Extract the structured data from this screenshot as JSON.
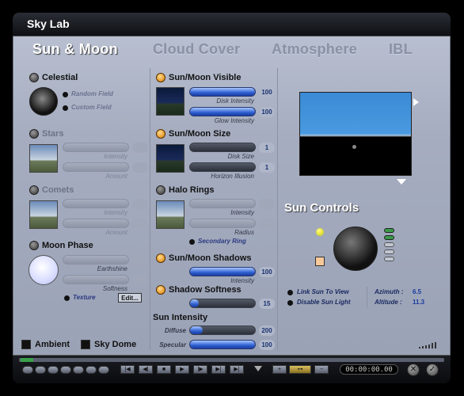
{
  "window": {
    "title": "Sky Lab"
  },
  "tabs": [
    {
      "label": "Sun & Moon",
      "active": true
    },
    {
      "label": "Cloud Cover",
      "active": false
    },
    {
      "label": "Atmosphere",
      "active": false
    },
    {
      "label": "IBL",
      "active": false
    }
  ],
  "left": {
    "celestial": {
      "label": "Celestial",
      "random_field": "Random Field",
      "custom_field": "Custom Field"
    },
    "stars": {
      "label": "Stars",
      "intensity": "Intensity",
      "amount": "Amount"
    },
    "comets": {
      "label": "Comets",
      "intensity": "Intensity",
      "amount": "Amount"
    },
    "moon_phase": {
      "label": "Moon Phase",
      "earthshine": "Earthshine",
      "softness": "Softness",
      "texture": "Texture",
      "edit": "Edit..."
    },
    "ambient": "Ambient",
    "sky_dome": "Sky Dome"
  },
  "middle": {
    "sun_moon_visible": {
      "label": "Sun/Moon Visible",
      "disk_intensity": "Disk Intensity",
      "disk_intensity_value": "100",
      "glow_intensity": "Glow Intensity",
      "glow_intensity_value": "100"
    },
    "sun_moon_size": {
      "label": "Sun/Moon Size",
      "disk_size": "Disk Size",
      "disk_size_value": "1",
      "horizon_illusion": "Horizon Illusion",
      "horizon_illusion_value": "1"
    },
    "halo_rings": {
      "label": "Halo Rings",
      "intensity": "Intensity",
      "radius": "Radius",
      "secondary_ring": "Secondary Ring"
    },
    "sun_moon_shadows": {
      "label": "Sun/Moon Shadows",
      "intensity": "Intensity",
      "intensity_value": "100"
    },
    "shadow_softness": {
      "label": "Shadow Softness",
      "value": "15"
    },
    "sun_intensity": {
      "label": "Sun Intensity",
      "diffuse": "Diffuse",
      "diffuse_value": "200",
      "specular": "Specular",
      "specular_value": "100"
    }
  },
  "right": {
    "sun_controls": "Sun Controls",
    "link_sun_to_view": "Link Sun To View",
    "disable_sun_light": "Disable Sun Light",
    "azimuth_label": "Azimuth :",
    "azimuth_value": "6.5",
    "altitude_label": "Altitude :",
    "altitude_value": "11.3"
  },
  "bottom": {
    "timecode": "00:00:00.00"
  }
}
